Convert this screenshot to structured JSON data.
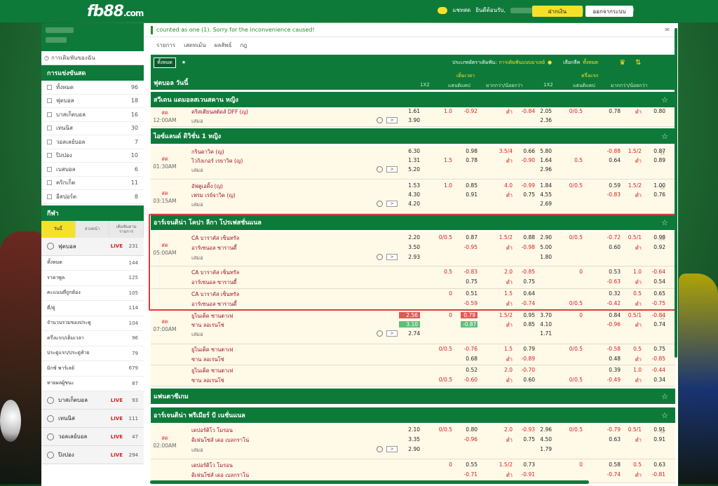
{
  "brand": {
    "logo": "fb88",
    "logo_suffix": ".com"
  },
  "topbar": {
    "chat": "แชทสด",
    "welcome": "ยินดีต้อนรับ,",
    "deposit": "ฝากเงิน",
    "logout": "ออกจากระบบ",
    "colors": {
      "green": "#0e7a3a",
      "yellow": "#f5e12a"
    }
  },
  "sidebar": {
    "favorites": "การเดิมพันของฉัน",
    "live_title": "การแข่งขันสด",
    "live_items": [
      {
        "label": "ทั้งหมด",
        "count": "96"
      },
      {
        "label": "ฟุตบอล",
        "count": "18"
      },
      {
        "label": "บาสเก็ตบอล",
        "count": "16"
      },
      {
        "label": "เทนนิส",
        "count": "30"
      },
      {
        "label": "วอลเลย์บอล",
        "count": "7"
      },
      {
        "label": "ปิงปอง",
        "count": "10"
      },
      {
        "label": "เบสบอล",
        "count": "6"
      },
      {
        "label": "คริกเก็ต",
        "count": "11"
      },
      {
        "label": "อีสปอร์ต",
        "count": "8"
      }
    ],
    "sports_title": "กีฬา",
    "tabs": [
      "วันนี้",
      "ล่วงหน้า",
      "เดิมพันตามรายการ"
    ],
    "football": {
      "label": "ฟุตบอล",
      "live": "LIVE",
      "count": "231"
    },
    "football_items": [
      {
        "label": "ทั้งหมด",
        "count": "144"
      },
      {
        "label": "ราคาพูล",
        "count": "125"
      },
      {
        "label": "คะแนนที่ถูกต้อง",
        "count": "105"
      },
      {
        "label": "คี่/คู่",
        "count": "114"
      },
      {
        "label": "จำนวนรวมของประตู",
        "count": "104"
      },
      {
        "label": "ครึ่งแรก/เต็มเวลา",
        "count": "96"
      },
      {
        "label": "ประตูแรก/ประตูท้าย",
        "count": "79"
      },
      {
        "label": "มิกซ์ พาร์เลย์",
        "count": "679"
      },
      {
        "label": "ทายผลผู้ชนะ",
        "count": "87"
      }
    ],
    "other_sports": [
      {
        "label": "บาสเก็ตบอล",
        "live": "LIVE",
        "count": "93"
      },
      {
        "label": "เทนนิส",
        "live": "LIVE",
        "count": "111"
      },
      {
        "label": "วอลเลย์บอล",
        "live": "LIVE",
        "count": "47"
      },
      {
        "label": "ปิงปอง",
        "live": "LIVE",
        "count": "294"
      }
    ]
  },
  "main": {
    "notice": "counted as one (1). Sorry for the inconvenience caused!",
    "tabs": [
      "รายการ",
      "เสตทเม้น",
      "ผลลัพธ์",
      "กฎ"
    ],
    "filter": {
      "all": "ทั้งหมด",
      "bet_type_label": "ประเภทอัตราเดิมพัน:",
      "bet_type": "การเดิมพันแบบมาเลย์",
      "league_label": "เลือกลีค",
      "league": "ทั้งหมด"
    },
    "header": {
      "title": "ฟุตบอล วันนี้",
      "fulltime": "เต็มเวลา",
      "firsthalf": "ครึ่งแรก",
      "c1x2": "1X2",
      "chandicap": "แฮนดิแคป",
      "cou": "มากกว่า/น้อยกว่า",
      "c1x2b": "1X2",
      "chandicapb": "แฮนดิแคป",
      "coub": "มากกว่า/น้อยกว่า"
    },
    "live_word": "สด",
    "draw_word": "เสมอ",
    "under_word": "ต่ำ",
    "more_icon": ">",
    "leagues": [
      {
        "name": "สวีเดน แดมอลสเวนสคาน หญิง"
      },
      {
        "name": "ไอซ์แลนด์ ดิวิชั่น 1 หญิง"
      },
      {
        "name": "อาร์เจนติน่า โคปา ลีกา โปรเฟสชั่นแนล"
      },
      {
        "name": "แฟนตาซีเกม"
      },
      {
        "name": "อาร์เจนติน่า พรีเมียร์ บี เนชั่นแนล"
      }
    ],
    "matches": {
      "m0": {
        "time": "12:00AM",
        "home": "คริสเตียนสตัดส์ DFF (ญ)",
        "h1x2": "1.61",
        "hhd": "1.0",
        "hodd": "-0.92",
        "hou": "ต่ำ",
        "houo": "-0.84",
        "h1x2b": "2.05",
        "hhdb": "0/0.5",
        "hoddb": "0.78",
        "houb": "ต่ำ",
        "houob": "0.80",
        "draw": "3.90",
        "drawb": "2.36"
      },
      "m1": {
        "time": "01:30AM",
        "home": "กรินดาวิค (ญ)",
        "away": "ไวกิงเกอร์ เรยาวิค (ญ)",
        "h1x2": "6.30",
        "a1x2": "1.31",
        "draw": "5.20",
        "hodd": "0.98",
        "ahd": "1.5",
        "aodd": "0.78",
        "hou": "3.5/4",
        "houo": "0.66",
        "aou": "ต่ำ",
        "aouo": "-0.90",
        "h1x2b": "5.80",
        "a1x2b": "1.64",
        "drawb": "2.96",
        "hoddb": "-0.88",
        "ahdb": "0.5",
        "aoddb": "0.64",
        "houb": "1.5/2",
        "houob": "0.87",
        "aoub": "ต่ำ",
        "aouob": "0.89"
      },
      "m2": {
        "time": "03:15AM",
        "home": "อัฟตูเอดิ้ง (ญ)",
        "away": "เฟรม เรย์จาวิค (ญ)",
        "h1x2": "1.53",
        "a1x2": "4.30",
        "draw": "4.20",
        "hhd": "1.0",
        "hodd": "0.85",
        "aodd": "0.91",
        "hou": "4.0",
        "houo": "-0.99",
        "aou": "ต่ำ",
        "aouo": "0.75",
        "h1x2b": "1.84",
        "a1x2b": "4.55",
        "drawb": "2.69",
        "hhdb": "0/0.5",
        "hoddb": "0.59",
        "aoddb": "-0.83",
        "houb": "1.5/2",
        "houob": "1.00",
        "aoub": "ต่ำ",
        "aouob": "0.76"
      },
      "m3": {
        "time": "05:00AM",
        "home": "CA บาราคัส เซ็นทรัล",
        "away": "อาร์เซนอล ซารานดี้",
        "h1x2": "2.20",
        "a1x2": "3.50",
        "draw": "2.93",
        "hhd": "0/0.5",
        "hodd": "0.87",
        "aodd": "-0.95",
        "hou": "1.5/2",
        "houo": "0.88",
        "aou": "ต่ำ",
        "aouo": "-0.98",
        "h1x2b": "2.90",
        "a1x2b": "5.00",
        "drawb": "1.80",
        "hhdb": "0/0.5",
        "hoddb": "-0.72",
        "aoddb": "0.60",
        "houb": "0.5/1",
        "houob": "0.98",
        "aoub": "ต่ำ",
        "aouob": "0.92"
      },
      "m3b": {
        "home": "CA บาราคัส เซ็นทรัล",
        "away": "อาร์เซนอล ซารานดี้",
        "hhd": "0.5",
        "hodd": "-0.83",
        "aodd": "0.75",
        "hou": "2.0",
        "houo": "-0.85",
        "aou": "ต่ำ",
        "aouo": "0.75",
        "hhdb": "0",
        "hoddb": "0.53",
        "aoddb": "-0.63",
        "houb": "1.0",
        "houob": "-0.64",
        "aoub": "ต่ำ",
        "aouob": "0.54"
      },
      "m3c": {
        "home": "CA บาราคัส เซ็นทรัล",
        "away": "อาร์เซนอล ซารานดี้",
        "hhd": "0",
        "hodd": "0.51",
        "ahd": "",
        "aodd": "-0.59",
        "hou": "1.5",
        "houo": "0.64",
        "aou": "ต่ำ",
        "aouo": "-0.74",
        "hoddb": "0.32",
        "ahdb": "0/0.5",
        "aoddb": "-0.42",
        "houb": "0.5",
        "houob": "0.65",
        "aoub": "ต่ำ",
        "aouob": "-0.75"
      },
      "m4": {
        "time": "07:00AM",
        "home": "ยูไนเต็ด ซานตาเฟ",
        "away": "ซาน ลอเรนโซ่",
        "h1x2": "2.56",
        "a1x2": "3.10",
        "draw": "2.74",
        "hhd": "0",
        "hodd": "0.79",
        "aodd": "-0.87",
        "hou": "1.5/2",
        "houo": "0.95",
        "aou": "ต่ำ",
        "aouo": "0.85",
        "h1x2b": "3.70",
        "a1x2b": "4.10",
        "drawb": "1.71",
        "hhdb": "0",
        "hoddb": "0.84",
        "aoddb": "-0.96",
        "houb": "0.5/1",
        "houob": "-0.84",
        "aoub": "ต่ำ",
        "aouob": "0.74"
      },
      "m4b": {
        "home": "ยูไนเต็ด ซานตาเฟ",
        "away": "ซาน ลอเรนโซ่",
        "hhd": "0/0.5",
        "hodd": "-0.76",
        "aodd": "0.68",
        "hou": "1.5",
        "houo": "0.79",
        "aou": "ต่ำ",
        "aouo": "-0.89",
        "hhdb": "0/0.5",
        "hoddb": "-0.58",
        "aoddb": "0.48",
        "houb": "0.5",
        "houob": "0.75",
        "aoub": "ต่ำ",
        "aouob": "-0.85"
      },
      "m4c": {
        "home": "ยูไนเต็ด ซานตาเฟ",
        "away": "ซาน ลอเรนโซ่",
        "hodd": "0.52",
        "ahd": "0/0.5",
        "aodd": "-0.60",
        "hou": "2.0",
        "houo": "-0.70",
        "aou": "ต่ำ",
        "aouo": "0.60",
        "hoddb": "0.39",
        "ahdb": "0/0.5",
        "aoddb": "-0.49",
        "houb": "1.0",
        "houob": "-0.44",
        "aoub": "ต่ำ",
        "aouob": "0.34"
      },
      "m5": {
        "time": "02:00AM",
        "home": "เดปอร์ติโว โมรอน",
        "away": "ดิเฟนโซ่ส์ เดอ เบลกราโน่",
        "h1x2": "2.10",
        "a1x2": "3.35",
        "draw": "2.90",
        "hhd": "0/0.5",
        "hodd": "0.80",
        "aodd": "-0.96",
        "hou": "2.0",
        "houo": "-0.93",
        "aou": "ต่ำ",
        "aouo": "0.75",
        "h1x2b": "2.96",
        "a1x2b": "4.50",
        "drawb": "1.79",
        "hhdb": "0/0.5",
        "hoddb": "-0.79",
        "aoddb": "0.63",
        "houb": "0.5/1",
        "houob": "0.91",
        "aoub": "ต่ำ",
        "aouob": "0.91"
      },
      "m5b": {
        "home": "เดปอร์ติโว โมรอน",
        "away": "ดิเฟนโซ่ส์ เดอ เบลกราโน่",
        "hhd": "0",
        "hodd": "0.55",
        "aodd": "-0.71",
        "hou": "1.5/2",
        "houo": "0.73",
        "aou": "ต่ำ",
        "aouo": "-0.91",
        "hhdb": "0",
        "hoddb": "0.58",
        "aoddb": "-0.74",
        "houb": "0.5",
        "houob": "0.63",
        "aoub": "ต่ำ",
        "aouob": "-0.81"
      }
    }
  }
}
